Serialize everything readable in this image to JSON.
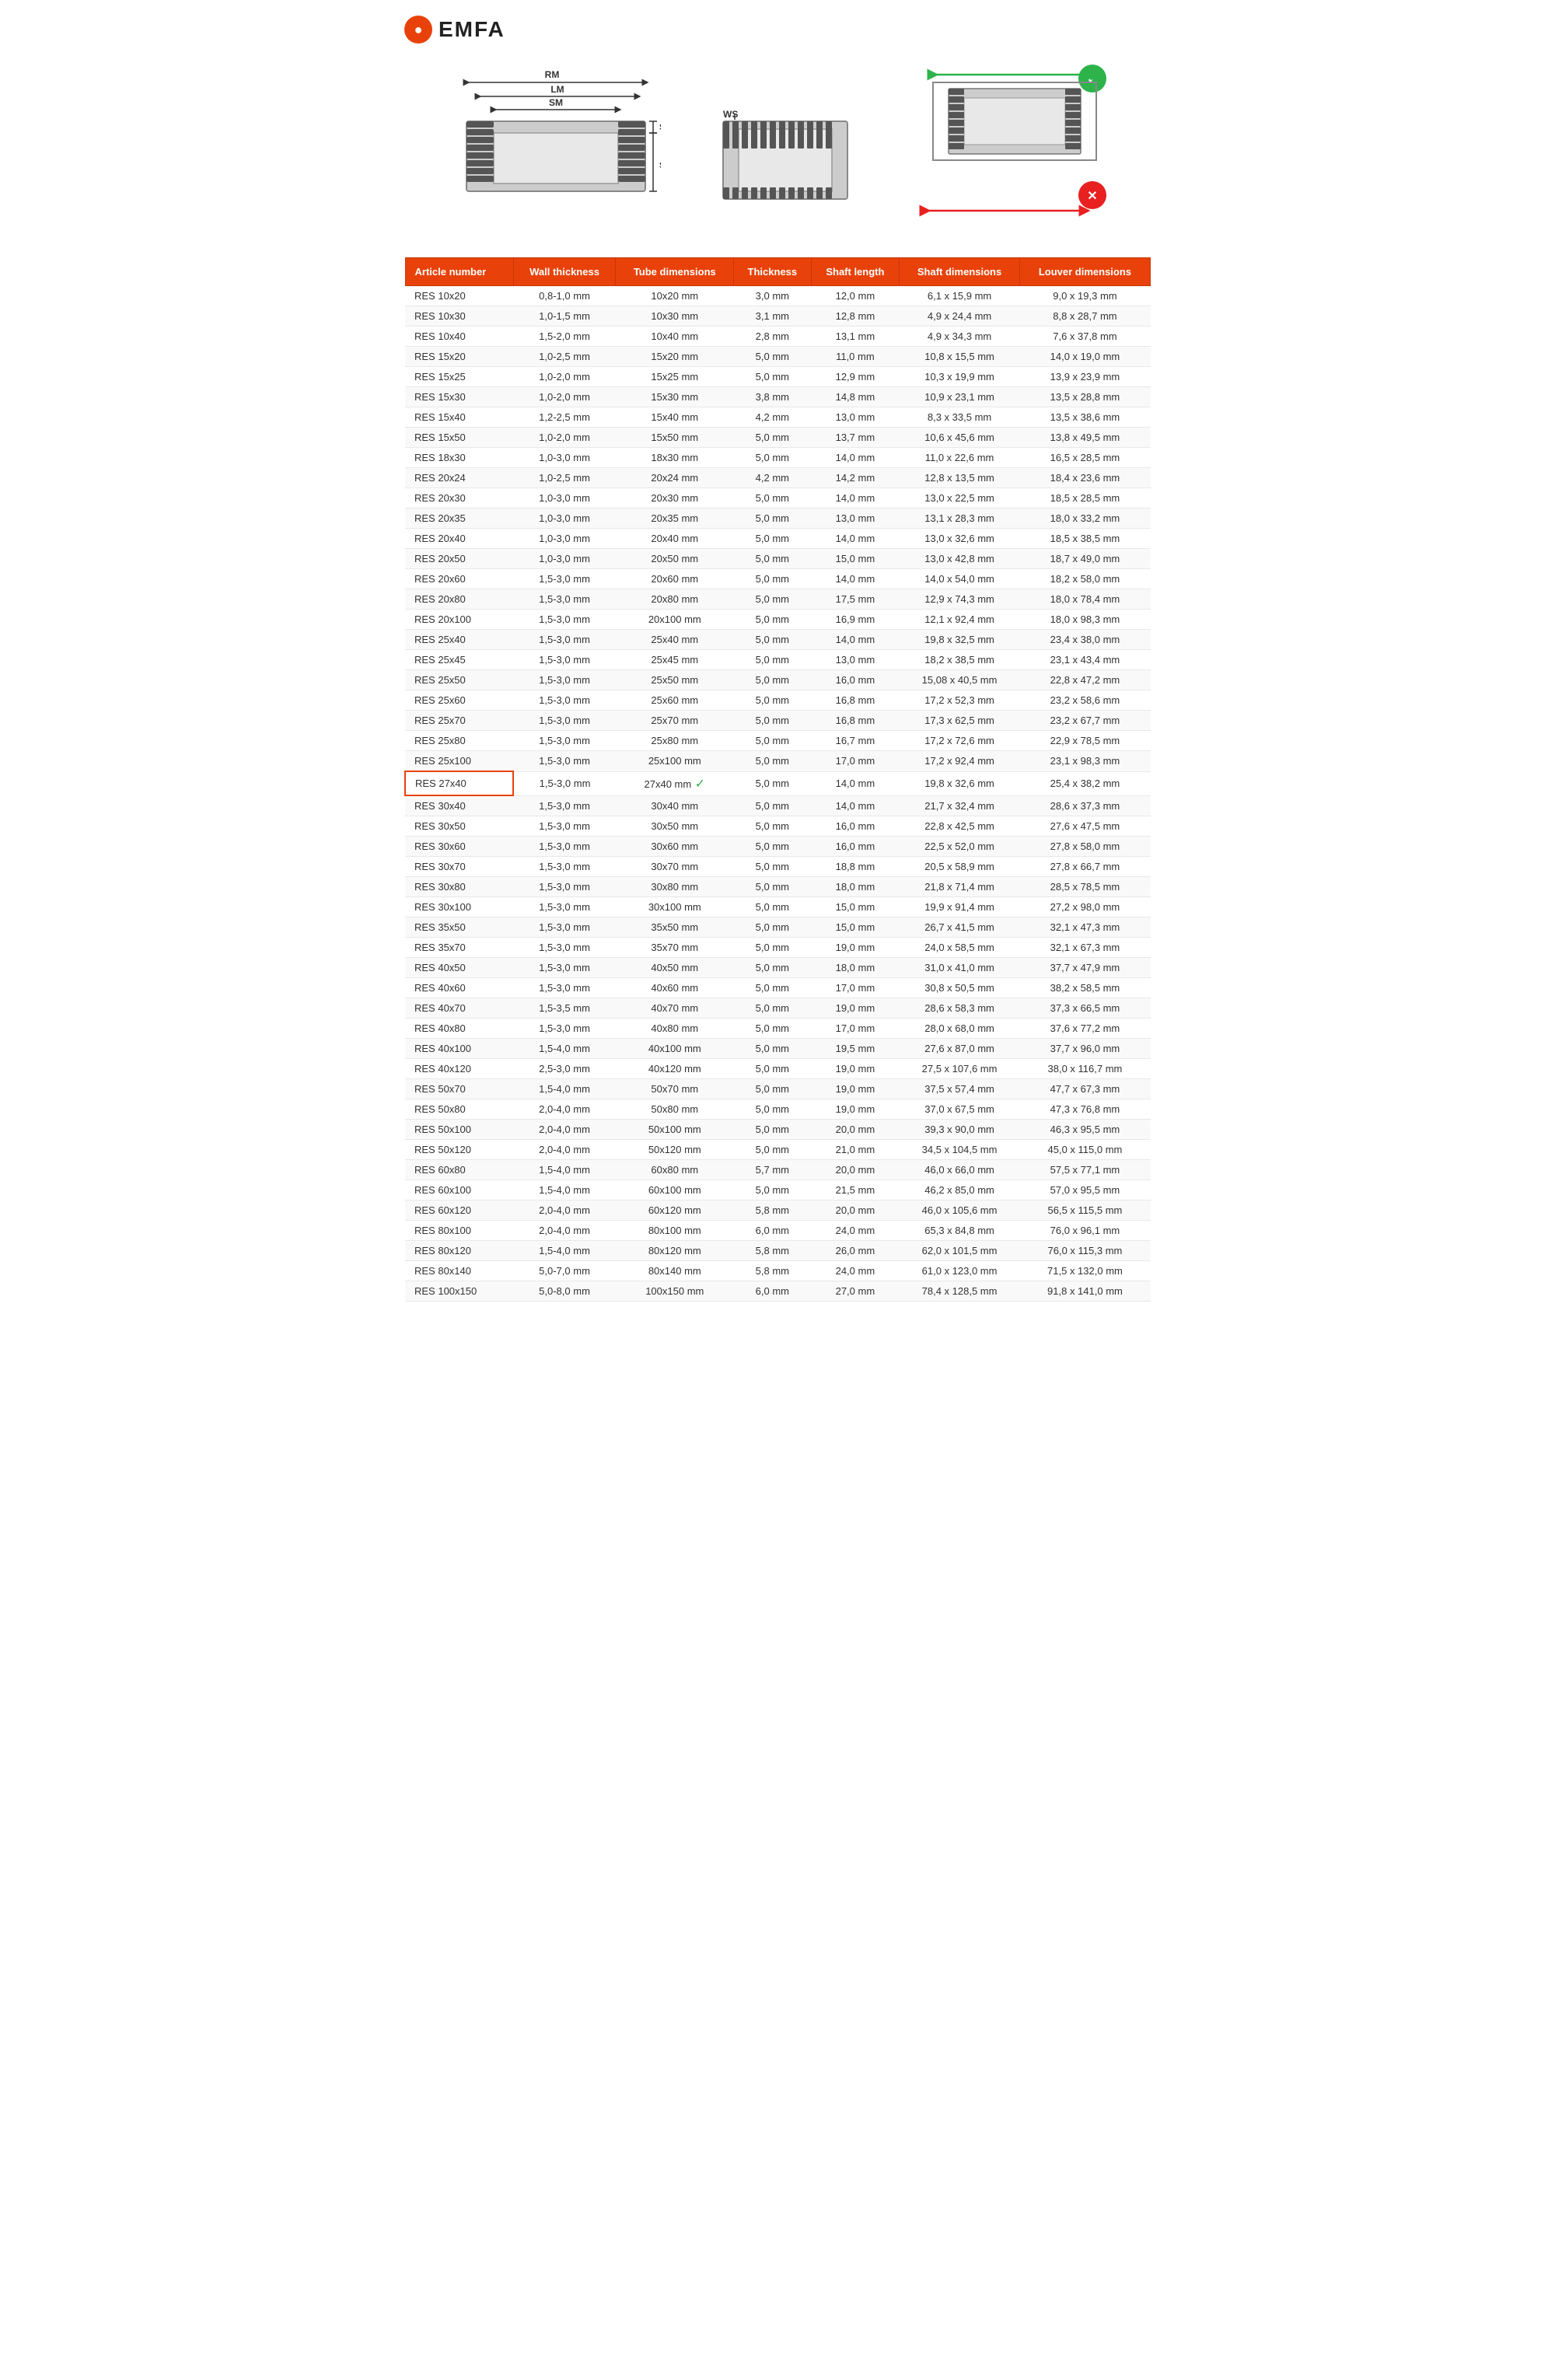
{
  "logo": {
    "icon": "●",
    "text": "EMFA"
  },
  "diagram1": {
    "labels": {
      "RM": "RM",
      "LM": "LM",
      "SM": "SM",
      "SK": "SK",
      "SE": "SE"
    }
  },
  "diagram2": {
    "labels": {
      "WS": "WS"
    }
  },
  "diagram3": {
    "check": "✓",
    "cross": "✗"
  },
  "table": {
    "headers": [
      "Article number",
      "Wall thickness",
      "Tube dimensions",
      "Thickness",
      "Shaft length",
      "Shaft dimensions",
      "Louver dimensions"
    ],
    "rows": [
      [
        "RES 10x20",
        "0,8-1,0 mm",
        "10x20 mm",
        "3,0 mm",
        "12,0 mm",
        "6,1 x 15,9 mm",
        "9,0 x 19,3 mm"
      ],
      [
        "RES 10x30",
        "1,0-1,5 mm",
        "10x30 mm",
        "3,1 mm",
        "12,8 mm",
        "4,9 x 24,4 mm",
        "8,8 x 28,7 mm"
      ],
      [
        "RES 10x40",
        "1,5-2,0 mm",
        "10x40 mm",
        "2,8 mm",
        "13,1 mm",
        "4,9 x 34,3 mm",
        "7,6 x 37,8 mm"
      ],
      [
        "RES 15x20",
        "1,0-2,5 mm",
        "15x20 mm",
        "5,0 mm",
        "11,0 mm",
        "10,8 x 15,5 mm",
        "14,0 x 19,0 mm"
      ],
      [
        "RES 15x25",
        "1,0-2,0 mm",
        "15x25 mm",
        "5,0 mm",
        "12,9 mm",
        "10,3 x 19,9 mm",
        "13,9 x 23,9 mm"
      ],
      [
        "RES 15x30",
        "1,0-2,0 mm",
        "15x30 mm",
        "3,8 mm",
        "14,8 mm",
        "10,9 x 23,1 mm",
        "13,5 x 28,8 mm"
      ],
      [
        "RES 15x40",
        "1,2-2,5 mm",
        "15x40 mm",
        "4,2 mm",
        "13,0 mm",
        "8,3 x 33,5 mm",
        "13,5 x 38,6 mm"
      ],
      [
        "RES 15x50",
        "1,0-2,0 mm",
        "15x50 mm",
        "5,0 mm",
        "13,7 mm",
        "10,6 x 45,6 mm",
        "13,8 x 49,5 mm"
      ],
      [
        "RES 18x30",
        "1,0-3,0 mm",
        "18x30 mm",
        "5,0 mm",
        "14,0 mm",
        "11,0 x 22,6 mm",
        "16,5 x 28,5 mm"
      ],
      [
        "RES 20x24",
        "1,0-2,5 mm",
        "20x24 mm",
        "4,2 mm",
        "14,2 mm",
        "12,8 x 13,5 mm",
        "18,4 x 23,6 mm"
      ],
      [
        "RES 20x30",
        "1,0-3,0 mm",
        "20x30 mm",
        "5,0 mm",
        "14,0 mm",
        "13,0 x 22,5 mm",
        "18,5 x 28,5 mm"
      ],
      [
        "RES 20x35",
        "1,0-3,0 mm",
        "20x35 mm",
        "5,0 mm",
        "13,0 mm",
        "13,1 x 28,3 mm",
        "18,0 x 33,2 mm"
      ],
      [
        "RES 20x40",
        "1,0-3,0 mm",
        "20x40 mm",
        "5,0 mm",
        "14,0 mm",
        "13,0 x 32,6 mm",
        "18,5 x 38,5 mm"
      ],
      [
        "RES 20x50",
        "1,0-3,0 mm",
        "20x50 mm",
        "5,0 mm",
        "15,0 mm",
        "13,0 x 42,8 mm",
        "18,7 x 49,0 mm"
      ],
      [
        "RES 20x60",
        "1,5-3,0 mm",
        "20x60 mm",
        "5,0 mm",
        "14,0 mm",
        "14,0 x 54,0 mm",
        "18,2 x 58,0 mm"
      ],
      [
        "RES 20x80",
        "1,5-3,0 mm",
        "20x80 mm",
        "5,0 mm",
        "17,5 mm",
        "12,9 x 74,3 mm",
        "18,0 x 78,4 mm"
      ],
      [
        "RES 20x100",
        "1,5-3,0 mm",
        "20x100 mm",
        "5,0 mm",
        "16,9 mm",
        "12,1 x 92,4 mm",
        "18,0 x 98,3 mm"
      ],
      [
        "RES 25x40",
        "1,5-3,0 mm",
        "25x40 mm",
        "5,0 mm",
        "14,0 mm",
        "19,8 x 32,5 mm",
        "23,4 x 38,0 mm"
      ],
      [
        "RES 25x45",
        "1,5-3,0 mm",
        "25x45 mm",
        "5,0 mm",
        "13,0 mm",
        "18,2 x 38,5 mm",
        "23,1 x 43,4 mm"
      ],
      [
        "RES 25x50",
        "1,5-3,0 mm",
        "25x50 mm",
        "5,0 mm",
        "16,0 mm",
        "15,08 x 40,5 mm",
        "22,8 x 47,2 mm"
      ],
      [
        "RES 25x60",
        "1,5-3,0 mm",
        "25x60 mm",
        "5,0 mm",
        "16,8 mm",
        "17,2 x 52,3 mm",
        "23,2 x 58,6 mm"
      ],
      [
        "RES 25x70",
        "1,5-3,0 mm",
        "25x70 mm",
        "5,0 mm",
        "16,8 mm",
        "17,3 x 62,5 mm",
        "23,2 x 67,7 mm"
      ],
      [
        "RES 25x80",
        "1,5-3,0 mm",
        "25x80 mm",
        "5,0 mm",
        "16,7 mm",
        "17,2 x 72,6 mm",
        "22,9 x 78,5 mm"
      ],
      [
        "RES 25x100",
        "1,5-3,0 mm",
        "25x100 mm",
        "5,0 mm",
        "17,0 mm",
        "17,2 x 92,4 mm",
        "23,1 x 98,3 mm"
      ],
      [
        "RES 27x40",
        "1,5-3,0 mm",
        "27x40 mm",
        "5,0 mm",
        "14,0 mm",
        "19,8 x 32,6 mm",
        "25,4 x 38,2 mm",
        true
      ],
      [
        "RES 30x40",
        "1,5-3,0 mm",
        "30x40 mm",
        "5,0 mm",
        "14,0 mm",
        "21,7 x 32,4 mm",
        "28,6 x 37,3 mm"
      ],
      [
        "RES 30x50",
        "1,5-3,0 mm",
        "30x50 mm",
        "5,0 mm",
        "16,0 mm",
        "22,8 x 42,5 mm",
        "27,6 x 47,5 mm"
      ],
      [
        "RES 30x60",
        "1,5-3,0 mm",
        "30x60 mm",
        "5,0 mm",
        "16,0 mm",
        "22,5 x 52,0 mm",
        "27,8 x 58,0 mm"
      ],
      [
        "RES 30x70",
        "1,5-3,0 mm",
        "30x70 mm",
        "5,0 mm",
        "18,8 mm",
        "20,5 x 58,9 mm",
        "27,8 x 66,7 mm"
      ],
      [
        "RES 30x80",
        "1,5-3,0 mm",
        "30x80 mm",
        "5,0 mm",
        "18,0 mm",
        "21,8 x 71,4 mm",
        "28,5 x 78,5 mm"
      ],
      [
        "RES 30x100",
        "1,5-3,0 mm",
        "30x100 mm",
        "5,0 mm",
        "15,0 mm",
        "19,9 x 91,4 mm",
        "27,2 x 98,0 mm"
      ],
      [
        "RES 35x50",
        "1,5-3,0 mm",
        "35x50 mm",
        "5,0 mm",
        "15,0 mm",
        "26,7 x 41,5 mm",
        "32,1 x 47,3 mm"
      ],
      [
        "RES 35x70",
        "1,5-3,0 mm",
        "35x70 mm",
        "5,0 mm",
        "19,0 mm",
        "24,0 x 58,5 mm",
        "32,1 x 67,3 mm"
      ],
      [
        "RES 40x50",
        "1,5-3,0 mm",
        "40x50 mm",
        "5,0 mm",
        "18,0 mm",
        "31,0 x 41,0 mm",
        "37,7 x 47,9 mm"
      ],
      [
        "RES 40x60",
        "1,5-3,0 mm",
        "40x60 mm",
        "5,0 mm",
        "17,0 mm",
        "30,8 x 50,5 mm",
        "38,2 x 58,5 mm"
      ],
      [
        "RES 40x70",
        "1,5-3,5 mm",
        "40x70 mm",
        "5,0 mm",
        "19,0 mm",
        "28,6 x 58,3 mm",
        "37,3 x 66,5 mm"
      ],
      [
        "RES 40x80",
        "1,5-3,0 mm",
        "40x80 mm",
        "5,0 mm",
        "17,0 mm",
        "28,0 x 68,0 mm",
        "37,6 x 77,2 mm"
      ],
      [
        "RES 40x100",
        "1,5-4,0 mm",
        "40x100 mm",
        "5,0 mm",
        "19,5 mm",
        "27,6 x 87,0 mm",
        "37,7 x 96,0 mm"
      ],
      [
        "RES 40x120",
        "2,5-3,0 mm",
        "40x120 mm",
        "5,0 mm",
        "19,0 mm",
        "27,5 x 107,6 mm",
        "38,0 x 116,7 mm"
      ],
      [
        "RES 50x70",
        "1,5-4,0 mm",
        "50x70 mm",
        "5,0 mm",
        "19,0 mm",
        "37,5 x 57,4 mm",
        "47,7 x 67,3 mm"
      ],
      [
        "RES 50x80",
        "2,0-4,0 mm",
        "50x80 mm",
        "5,0 mm",
        "19,0 mm",
        "37,0 x 67,5 mm",
        "47,3 x 76,8 mm"
      ],
      [
        "RES 50x100",
        "2,0-4,0 mm",
        "50x100 mm",
        "5,0 mm",
        "20,0 mm",
        "39,3 x 90,0 mm",
        "46,3 x 95,5 mm"
      ],
      [
        "RES 50x120",
        "2,0-4,0 mm",
        "50x120 mm",
        "5,0 mm",
        "21,0 mm",
        "34,5 x 104,5 mm",
        "45,0 x 115,0 mm"
      ],
      [
        "RES 60x80",
        "1,5-4,0 mm",
        "60x80 mm",
        "5,7 mm",
        "20,0 mm",
        "46,0 x 66,0 mm",
        "57,5 x 77,1 mm"
      ],
      [
        "RES 60x100",
        "1,5-4,0 mm",
        "60x100 mm",
        "5,0 mm",
        "21,5 mm",
        "46,2 x 85,0 mm",
        "57,0 x 95,5 mm"
      ],
      [
        "RES 60x120",
        "2,0-4,0 mm",
        "60x120 mm",
        "5,8 mm",
        "20,0 mm",
        "46,0 x 105,6 mm",
        "56,5 x 115,5 mm"
      ],
      [
        "RES 80x100",
        "2,0-4,0 mm",
        "80x100 mm",
        "6,0 mm",
        "24,0 mm",
        "65,3 x 84,8 mm",
        "76,0 x 96,1 mm"
      ],
      [
        "RES 80x120",
        "1,5-4,0 mm",
        "80x120 mm",
        "5,8 mm",
        "26,0 mm",
        "62,0 x 101,5 mm",
        "76,0 x 115,3 mm"
      ],
      [
        "RES 80x140",
        "5,0-7,0 mm",
        "80x140 mm",
        "5,8 mm",
        "24,0 mm",
        "61,0 x 123,0 mm",
        "71,5 x 132,0 mm"
      ],
      [
        "RES 100x150",
        "5,0-8,0 mm",
        "100x150 mm",
        "6,0 mm",
        "27,0 mm",
        "78,4 x 128,5 mm",
        "91,8 x 141,0 mm"
      ]
    ]
  }
}
